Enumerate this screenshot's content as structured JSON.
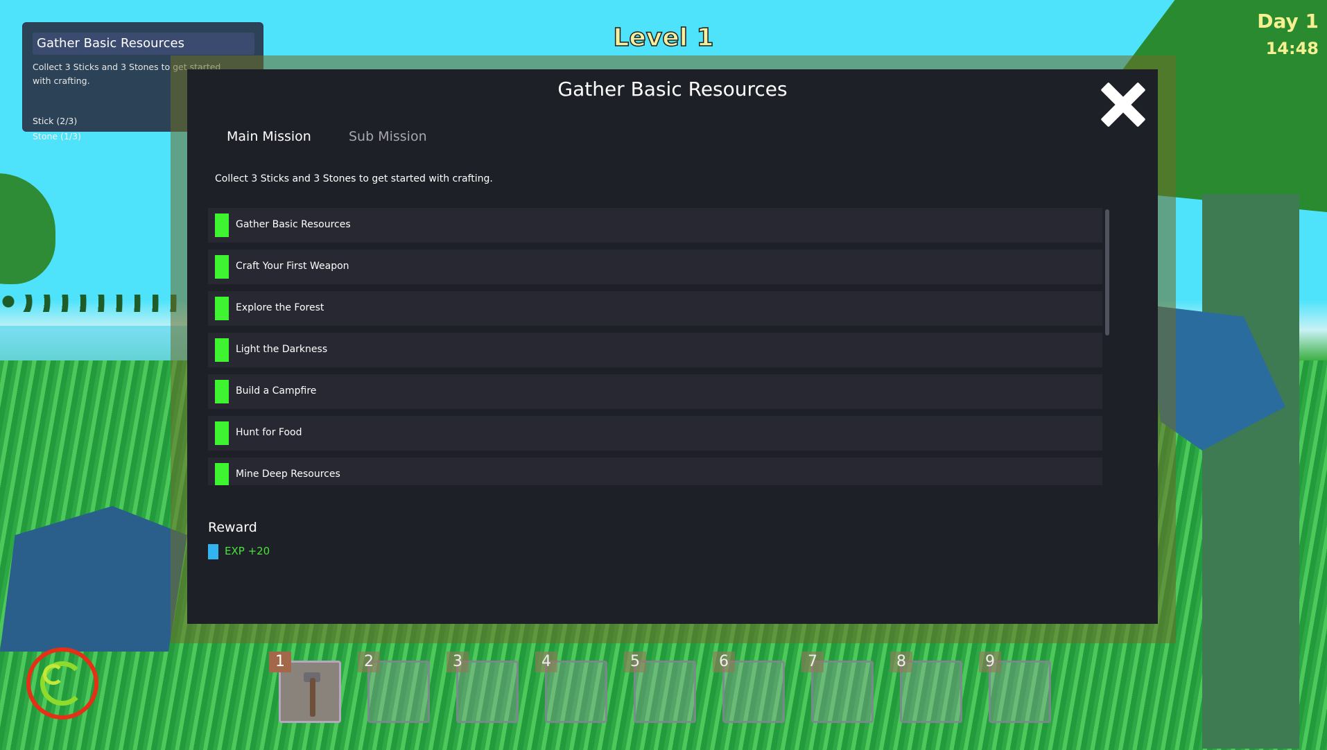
{
  "hud": {
    "level": "Level 1",
    "day": "Day 1",
    "time": "14:48"
  },
  "tracker": {
    "title": "Gather Basic Resources",
    "description": "Collect 3 Sticks and 3 Stones to get started with crafting.",
    "items": [
      "Stick (2/3)",
      "Stone (1/3)"
    ]
  },
  "modal": {
    "title": "Gather Basic Resources",
    "tabs": {
      "main": "Main Mission",
      "sub": "Sub Mission"
    },
    "description": "Collect 3 Sticks and 3 Stones to get started with crafting.",
    "missions": [
      "Gather Basic Resources",
      "Craft Your First Weapon",
      "Explore the Forest",
      "Light the Darkness",
      "Build a Campfire",
      "Hunt for Food",
      "Mine Deep Resources"
    ],
    "reward_title": "Reward",
    "reward": "EXP +20"
  },
  "hotbar": {
    "slots": [
      "1",
      "2",
      "3",
      "4",
      "5",
      "6",
      "7",
      "8",
      "9"
    ],
    "active_slot": "1",
    "slot1_item_icon": "hammer-icon"
  },
  "colors": {
    "mission_complete": "#3ef32f",
    "reward_exp": "#48e33c",
    "hud_text": "#f7f092"
  }
}
